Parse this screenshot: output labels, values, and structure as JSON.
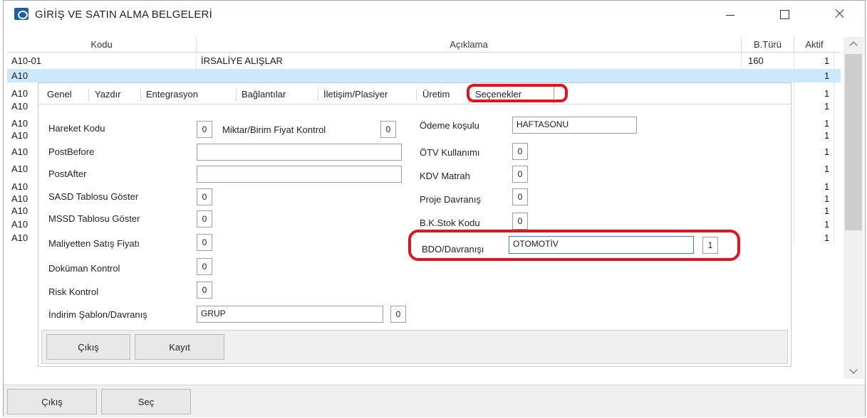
{
  "window": {
    "title": "GİRİŞ VE SATIN ALMA BELGELERİ"
  },
  "grid": {
    "columns": [
      "Kodu",
      "Açıklama",
      "B.Türü",
      "Aktif"
    ],
    "rows": [
      {
        "kodu": "A10-01",
        "aciklama": "İRSALİYE ALIŞLAR",
        "bturu": "160",
        "aktif": "1"
      },
      {
        "kodu": "A10",
        "aciklama": "",
        "bturu": "",
        "aktif": "1"
      },
      {
        "kodu": "A10",
        "aciklama": "",
        "bturu": "",
        "aktif": "1"
      },
      {
        "kodu": "A10",
        "aciklama": "",
        "bturu": "",
        "aktif": "1"
      },
      {
        "kodu": "A10",
        "aciklama": "",
        "bturu": "",
        "aktif": "1"
      },
      {
        "kodu": "A10",
        "aciklama": "",
        "bturu": "",
        "aktif": "1"
      },
      {
        "kodu": "A10",
        "aciklama": "",
        "bturu": "",
        "aktif": "1"
      },
      {
        "kodu": "A10",
        "aciklama": "",
        "bturu": "",
        "aktif": "1"
      },
      {
        "kodu": "A10",
        "aciklama": "",
        "bturu": "",
        "aktif": "1"
      },
      {
        "kodu": "A10",
        "aciklama": "",
        "bturu": "",
        "aktif": "1"
      },
      {
        "kodu": "A10",
        "aciklama": "",
        "bturu": "",
        "aktif": "1"
      },
      {
        "kodu": "A10",
        "aciklama": "",
        "bturu": "",
        "aktif": "1"
      },
      {
        "kodu": "A10",
        "aciklama": "",
        "bturu": "",
        "aktif": "1"
      }
    ]
  },
  "dialog": {
    "tabs": [
      "Genel",
      "Yazdır",
      "Entegrasyon",
      "Bağlantılar",
      "İletişim/Plasiyer",
      "Üretim",
      "Seçenekler"
    ],
    "active_tab": "Seçenekler",
    "left_fields": {
      "hareket_kodu": {
        "label": "Hareket Kodu",
        "value": "0"
      },
      "miktar_birim": {
        "label": "Miktar/Birim Fiyat Kontrol",
        "value": "0"
      },
      "post_before": {
        "label": "PostBefore",
        "value": ""
      },
      "post_after": {
        "label": "PostAfter",
        "value": ""
      },
      "sasd": {
        "label": "SASD Tablosu Göster",
        "value": "0"
      },
      "mssd": {
        "label": "MSSD Tablosu Göster",
        "value": "0"
      },
      "maliyetten": {
        "label": "Maliyetten Satış Fiyatı",
        "value": "0"
      },
      "dokuman": {
        "label": "Doküman Kontrol",
        "value": "0"
      },
      "risk": {
        "label": "Risk Kontrol",
        "value": "0"
      },
      "indirim": {
        "label": "İndirim Şablon/Davranış",
        "value": "GRUP",
        "num": "0"
      }
    },
    "right_fields": {
      "odeme": {
        "label": "Ödeme koşulu",
        "value": "HAFTASONU"
      },
      "otv": {
        "label": "ÖTV Kullanımı",
        "value": "0"
      },
      "kdv": {
        "label": "KDV Matrah",
        "value": "0"
      },
      "proje": {
        "label": "Proje Davranış",
        "value": "0"
      },
      "bk_stok": {
        "label": "B.K.Stok Kodu",
        "value": "0"
      },
      "bdo": {
        "label": "BDO/Davranışı",
        "value": "OTOMOTİV",
        "num": "1"
      }
    },
    "buttons": {
      "exit": "Çıkış",
      "save": "Kayıt"
    }
  },
  "footer": {
    "exit": "Çıkış",
    "select": "Seç"
  },
  "colors": {
    "highlight": "#e0141c",
    "selection": "#cce8ff"
  }
}
